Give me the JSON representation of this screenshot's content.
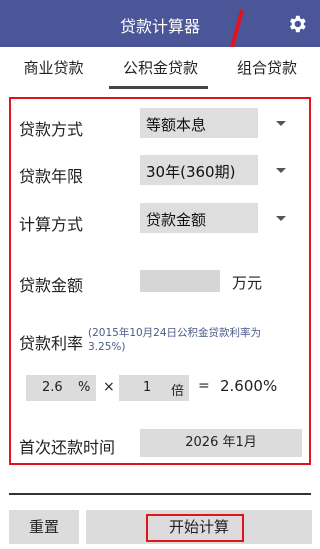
{
  "app": {
    "title": "贷款计算器"
  },
  "tabs": [
    "商业贷款",
    "公积金贷款",
    "组合贷款"
  ],
  "form": {
    "loan_method_label": "贷款方式",
    "loan_method_value": "等额本息",
    "loan_term_label": "贷款年限",
    "loan_term_value": "30年(360期)",
    "calc_method_label": "计算方式",
    "calc_method_value": "贷款金额",
    "loan_amount_label": "贷款金额",
    "loan_amount_value": "",
    "loan_amount_unit": "万元",
    "rate_label": "贷款利率",
    "rate_note": "(2015年10月24日公积金贷款利率为3.25%)",
    "base_rate": "2.6",
    "percent_sign": "%",
    "times_sign": "×",
    "multiplier": "1",
    "multiplier_unit": "倍",
    "equals_sign": "=",
    "result_rate": "2.600%",
    "first_payment_label": "首次还款时间",
    "first_payment_value": "2026 年1月"
  },
  "buttons": {
    "reset": "重置",
    "start": "开始计算"
  },
  "colors": {
    "header": "#4b5699",
    "highlight": "#e0141d"
  }
}
